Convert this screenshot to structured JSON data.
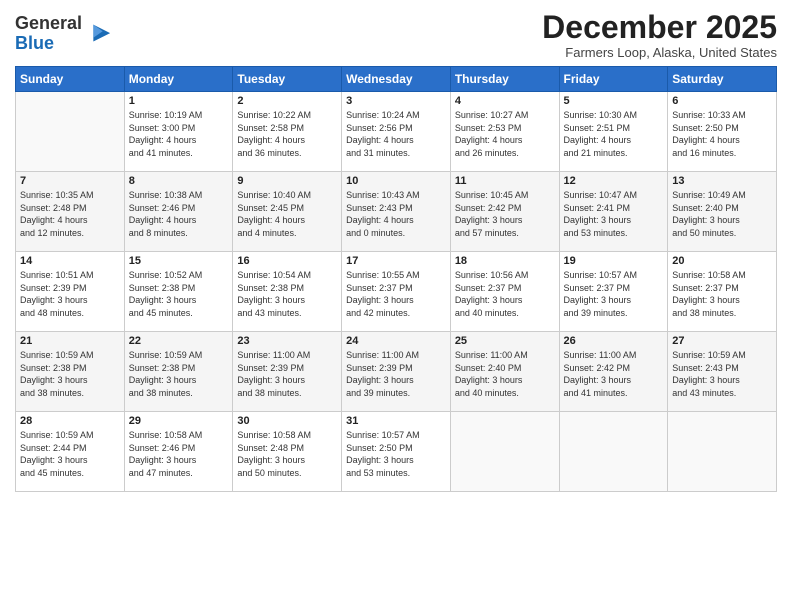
{
  "logo": {
    "general": "General",
    "blue": "Blue"
  },
  "header": {
    "month_title": "December 2025",
    "location": "Farmers Loop, Alaska, United States"
  },
  "weekdays": [
    "Sunday",
    "Monday",
    "Tuesday",
    "Wednesday",
    "Thursday",
    "Friday",
    "Saturday"
  ],
  "weeks": [
    [
      {
        "day": "",
        "info": ""
      },
      {
        "day": "1",
        "info": "Sunrise: 10:19 AM\nSunset: 3:00 PM\nDaylight: 4 hours\nand 41 minutes."
      },
      {
        "day": "2",
        "info": "Sunrise: 10:22 AM\nSunset: 2:58 PM\nDaylight: 4 hours\nand 36 minutes."
      },
      {
        "day": "3",
        "info": "Sunrise: 10:24 AM\nSunset: 2:56 PM\nDaylight: 4 hours\nand 31 minutes."
      },
      {
        "day": "4",
        "info": "Sunrise: 10:27 AM\nSunset: 2:53 PM\nDaylight: 4 hours\nand 26 minutes."
      },
      {
        "day": "5",
        "info": "Sunrise: 10:30 AM\nSunset: 2:51 PM\nDaylight: 4 hours\nand 21 minutes."
      },
      {
        "day": "6",
        "info": "Sunrise: 10:33 AM\nSunset: 2:50 PM\nDaylight: 4 hours\nand 16 minutes."
      }
    ],
    [
      {
        "day": "7",
        "info": "Sunrise: 10:35 AM\nSunset: 2:48 PM\nDaylight: 4 hours\nand 12 minutes."
      },
      {
        "day": "8",
        "info": "Sunrise: 10:38 AM\nSunset: 2:46 PM\nDaylight: 4 hours\nand 8 minutes."
      },
      {
        "day": "9",
        "info": "Sunrise: 10:40 AM\nSunset: 2:45 PM\nDaylight: 4 hours\nand 4 minutes."
      },
      {
        "day": "10",
        "info": "Sunrise: 10:43 AM\nSunset: 2:43 PM\nDaylight: 4 hours\nand 0 minutes."
      },
      {
        "day": "11",
        "info": "Sunrise: 10:45 AM\nSunset: 2:42 PM\nDaylight: 3 hours\nand 57 minutes."
      },
      {
        "day": "12",
        "info": "Sunrise: 10:47 AM\nSunset: 2:41 PM\nDaylight: 3 hours\nand 53 minutes."
      },
      {
        "day": "13",
        "info": "Sunrise: 10:49 AM\nSunset: 2:40 PM\nDaylight: 3 hours\nand 50 minutes."
      }
    ],
    [
      {
        "day": "14",
        "info": "Sunrise: 10:51 AM\nSunset: 2:39 PM\nDaylight: 3 hours\nand 48 minutes."
      },
      {
        "day": "15",
        "info": "Sunrise: 10:52 AM\nSunset: 2:38 PM\nDaylight: 3 hours\nand 45 minutes."
      },
      {
        "day": "16",
        "info": "Sunrise: 10:54 AM\nSunset: 2:38 PM\nDaylight: 3 hours\nand 43 minutes."
      },
      {
        "day": "17",
        "info": "Sunrise: 10:55 AM\nSunset: 2:37 PM\nDaylight: 3 hours\nand 42 minutes."
      },
      {
        "day": "18",
        "info": "Sunrise: 10:56 AM\nSunset: 2:37 PM\nDaylight: 3 hours\nand 40 minutes."
      },
      {
        "day": "19",
        "info": "Sunrise: 10:57 AM\nSunset: 2:37 PM\nDaylight: 3 hours\nand 39 minutes."
      },
      {
        "day": "20",
        "info": "Sunrise: 10:58 AM\nSunset: 2:37 PM\nDaylight: 3 hours\nand 38 minutes."
      }
    ],
    [
      {
        "day": "21",
        "info": "Sunrise: 10:59 AM\nSunset: 2:38 PM\nDaylight: 3 hours\nand 38 minutes."
      },
      {
        "day": "22",
        "info": "Sunrise: 10:59 AM\nSunset: 2:38 PM\nDaylight: 3 hours\nand 38 minutes."
      },
      {
        "day": "23",
        "info": "Sunrise: 11:00 AM\nSunset: 2:39 PM\nDaylight: 3 hours\nand 38 minutes."
      },
      {
        "day": "24",
        "info": "Sunrise: 11:00 AM\nSunset: 2:39 PM\nDaylight: 3 hours\nand 39 minutes."
      },
      {
        "day": "25",
        "info": "Sunrise: 11:00 AM\nSunset: 2:40 PM\nDaylight: 3 hours\nand 40 minutes."
      },
      {
        "day": "26",
        "info": "Sunrise: 11:00 AM\nSunset: 2:42 PM\nDaylight: 3 hours\nand 41 minutes."
      },
      {
        "day": "27",
        "info": "Sunrise: 10:59 AM\nSunset: 2:43 PM\nDaylight: 3 hours\nand 43 minutes."
      }
    ],
    [
      {
        "day": "28",
        "info": "Sunrise: 10:59 AM\nSunset: 2:44 PM\nDaylight: 3 hours\nand 45 minutes."
      },
      {
        "day": "29",
        "info": "Sunrise: 10:58 AM\nSunset: 2:46 PM\nDaylight: 3 hours\nand 47 minutes."
      },
      {
        "day": "30",
        "info": "Sunrise: 10:58 AM\nSunset: 2:48 PM\nDaylight: 3 hours\nand 50 minutes."
      },
      {
        "day": "31",
        "info": "Sunrise: 10:57 AM\nSunset: 2:50 PM\nDaylight: 3 hours\nand 53 minutes."
      },
      {
        "day": "",
        "info": ""
      },
      {
        "day": "",
        "info": ""
      },
      {
        "day": "",
        "info": ""
      }
    ]
  ]
}
